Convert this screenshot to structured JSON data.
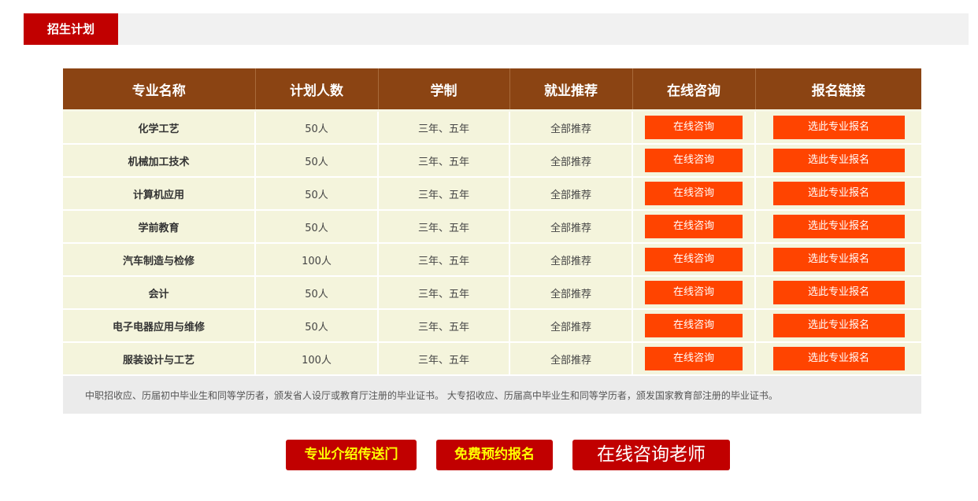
{
  "section": {
    "tab_label": "招生计划"
  },
  "table": {
    "headers": [
      "专业名称",
      "计划人数",
      "学制",
      "就业推荐",
      "在线咨询",
      "报名链接"
    ],
    "rows": [
      {
        "major": "化学工艺",
        "quota": "50人",
        "duration": "三年、五年",
        "employment": "全部推荐",
        "consult_label": "在线咨询",
        "signup_label": "选此专业报名"
      },
      {
        "major": "机械加工技术",
        "quota": "50人",
        "duration": "三年、五年",
        "employment": "全部推荐",
        "consult_label": "在线咨询",
        "signup_label": "选此专业报名"
      },
      {
        "major": "计算机应用",
        "quota": "50人",
        "duration": "三年、五年",
        "employment": "全部推荐",
        "consult_label": "在线咨询",
        "signup_label": "选此专业报名"
      },
      {
        "major": "学前教育",
        "quota": "50人",
        "duration": "三年、五年",
        "employment": "全部推荐",
        "consult_label": "在线咨询",
        "signup_label": "选此专业报名"
      },
      {
        "major": "汽车制造与检修",
        "quota": "100人",
        "duration": "三年、五年",
        "employment": "全部推荐",
        "consult_label": "在线咨询",
        "signup_label": "选此专业报名"
      },
      {
        "major": "会计",
        "quota": "50人",
        "duration": "三年、五年",
        "employment": "全部推荐",
        "consult_label": "在线咨询",
        "signup_label": "选此专业报名"
      },
      {
        "major": "电子电器应用与维修",
        "quota": "50人",
        "duration": "三年、五年",
        "employment": "全部推荐",
        "consult_label": "在线咨询",
        "signup_label": "选此专业报名"
      },
      {
        "major": "服装设计与工艺",
        "quota": "100人",
        "duration": "三年、五年",
        "employment": "全部推荐",
        "consult_label": "在线咨询",
        "signup_label": "选此专业报名"
      }
    ],
    "note": "中职招收应、历届初中毕业生和同等学历者，颁发省人设厅或教育厅注册的毕业证书。 大专招收应、历届高中毕业生和同等学历者，颁发国家教育部注册的毕业证书。"
  },
  "cta": {
    "intro_label": "专业介绍传送门",
    "reserve_label": "免费预约报名",
    "consult_label": "在线咨询老师"
  },
  "colors": {
    "brand_red": "#c10000",
    "header_brown": "#8b4413",
    "button_orange": "#ff4400",
    "row_bg": "#f4f4dc"
  }
}
